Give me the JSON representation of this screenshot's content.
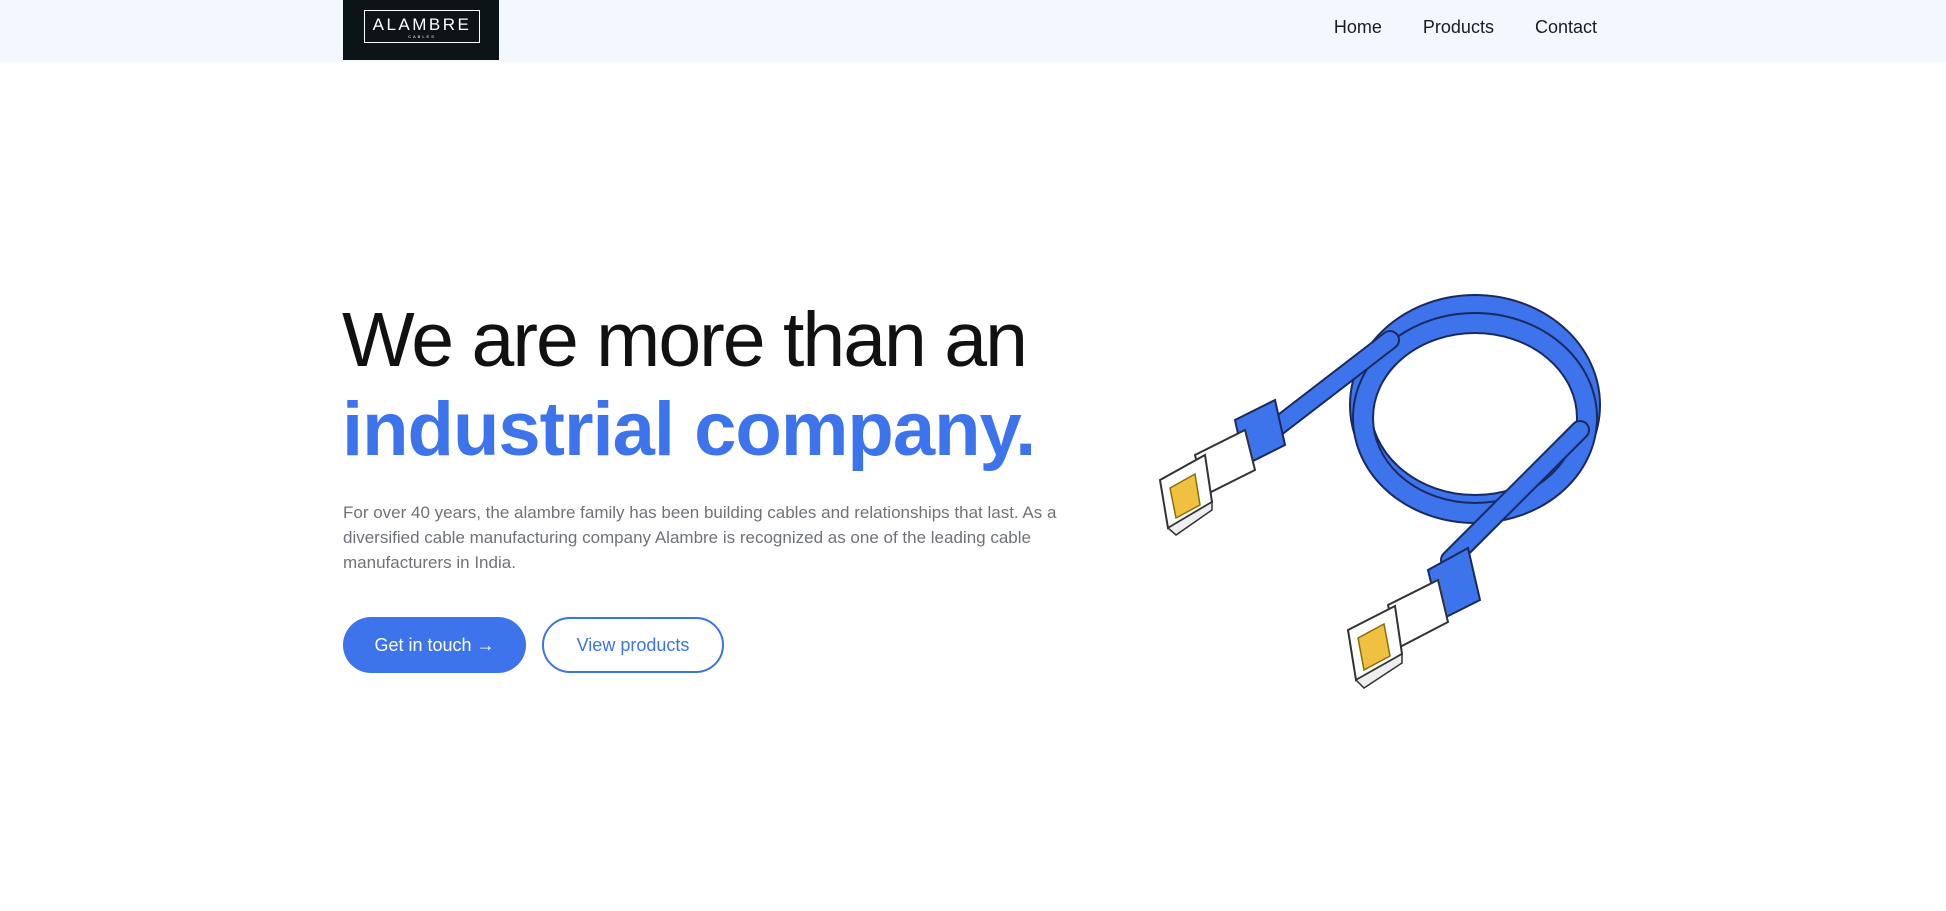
{
  "brand": {
    "name": "ALAMBRE",
    "tagline": "CABLES"
  },
  "nav": {
    "items": [
      {
        "label": "Home"
      },
      {
        "label": "Products"
      },
      {
        "label": "Contact"
      }
    ]
  },
  "hero": {
    "headline_line1": "We are more than an",
    "headline_line2": "industrial company.",
    "description": "For over 40 years, the alambre family has been building cables and relationships that last. As a diversified cable manufacturing company Alambre is recognized as one of the leading cable manufacturers in India.",
    "primary_button": "Get in touch →",
    "secondary_button": "View products"
  },
  "colors": {
    "accent": "#3d73eb",
    "nav_background": "#f3f7fe",
    "logo_background": "#0b1517",
    "connector_gold": "#f0c040"
  },
  "icons": {
    "illustration": "ethernet-cable-illustration"
  }
}
